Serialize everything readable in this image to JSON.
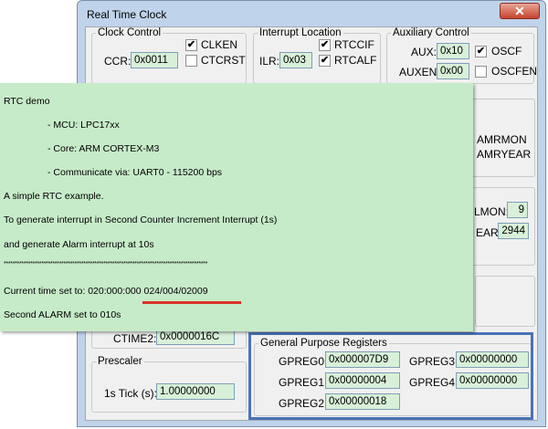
{
  "window": {
    "title": "Real Time Clock",
    "close_label": "✕"
  },
  "clock_control": {
    "legend": "Clock Control",
    "ccr_label": "CCR:",
    "ccr_value": "0x0011",
    "clken_label": "CLKEN",
    "clken_checked": "✔",
    "ctcrst_label": "CTCRST"
  },
  "interrupt_location": {
    "legend": "Interrupt Location",
    "ilr_label": "ILR:",
    "ilr_value": "0x03",
    "rtccif_label": "RTCCIF",
    "rtccif_checked": "✔",
    "rtcalf_label": "RTCALF",
    "rtcalf_checked": "✔"
  },
  "auxiliary_control": {
    "legend": "Auxiliary Control",
    "aux_label": "AUX:",
    "aux_value": "0x10",
    "osf_label": "OSCF",
    "osf_checked": "✔",
    "auxen_label": "AUXEN:",
    "auxen_value": "0x00",
    "oscfen_label": "OSCFEN"
  },
  "alarm_mask": {
    "amrmon": "AMRMON",
    "amryear": "AMRYEAR"
  },
  "alarm_values": {
    "almon_label": "LMON:",
    "almon_value": "9",
    "year_label": "EAR:",
    "year_value": "2944"
  },
  "ctime2": {
    "label": "CTIME2:",
    "value": "0x0000016C"
  },
  "prescaler": {
    "legend": "Prescaler",
    "tick_label": "1s Tick (s):",
    "tick_value": "1.00000000"
  },
  "gpreg": {
    "legend": "General Purpose Registers",
    "gpreg0_label": "GPREG0:",
    "gpreg0_value": "0x000007D9",
    "gpreg1_label": "GPREG1:",
    "gpreg1_value": "0x00000004",
    "gpreg2_label": "GPREG2:",
    "gpreg2_value": "0x00000018",
    "gpreg3_label": "GPREG3:",
    "gpreg3_value": "0x00000000",
    "gpreg4_label": "GPREG4:",
    "gpreg4_value": "0x00000000"
  },
  "console": {
    "lines": [
      "RTC demo",
      "- MCU: LPC17xx",
      "- Core: ARM CORTEX-M3",
      "- Communicate via: UART0 - 115200 bps",
      "A simple RTC example.",
      "To generate interrupt in Second Counter Increment Interrupt (1s)",
      "and generate Alarm interrupt at 10s",
      "********************************************************************************************",
      "Current time set to: 020:000:000  024/004/02009",
      "Second ALARM set to 010s"
    ]
  }
}
